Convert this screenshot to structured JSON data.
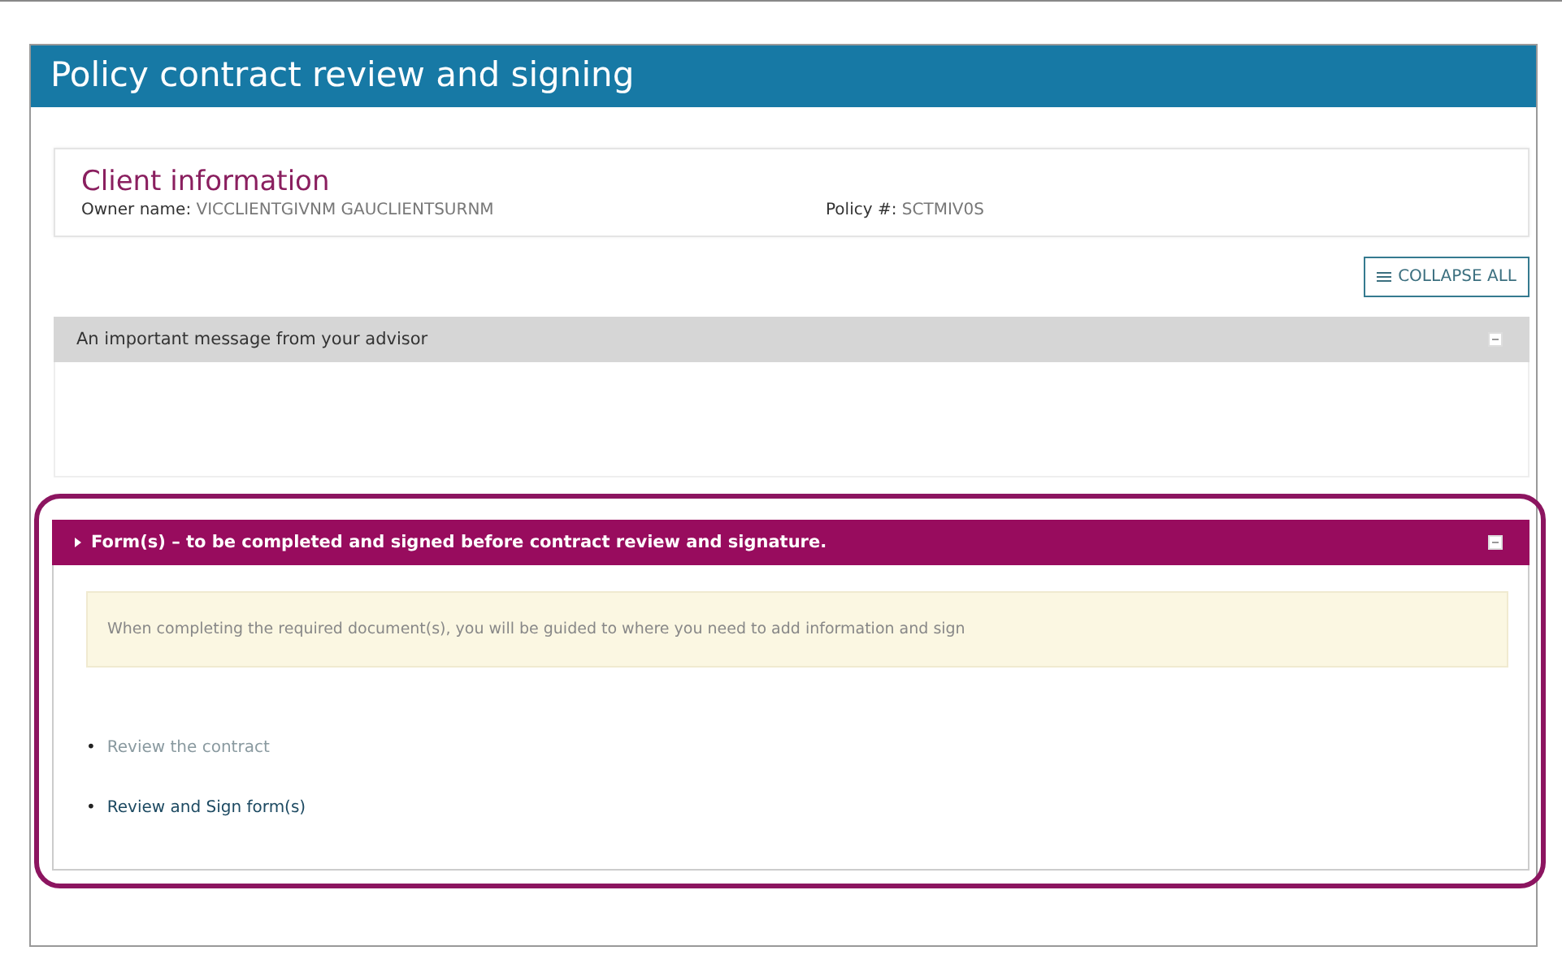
{
  "window": {
    "title": "Policy contract review and signing"
  },
  "client_info": {
    "heading": "Client information",
    "owner_label": "Owner name:",
    "owner_value": "VICCLIENTGIVNM GAUCLIENTSURNM",
    "policy_label": "Policy #:",
    "policy_value": "SCTMIV0S"
  },
  "collapse_all": {
    "label": "COLLAPSE ALL"
  },
  "sections": [
    {
      "kind": "message",
      "title": "An important message from your advisor",
      "expanded": true,
      "highlighted": false
    },
    {
      "kind": "forms",
      "title": "Form(s) – to be completed and signed before contract review and signature.",
      "expanded": true,
      "highlighted": true,
      "notice": "When completing the required document(s), you will be guided to where you need to add information and sign",
      "links": [
        {
          "bullet": "•",
          "label": "Review the contract",
          "disabled": true
        },
        {
          "bullet": "•",
          "label": "Review and Sign form(s)",
          "disabled": false
        }
      ]
    }
  ]
}
